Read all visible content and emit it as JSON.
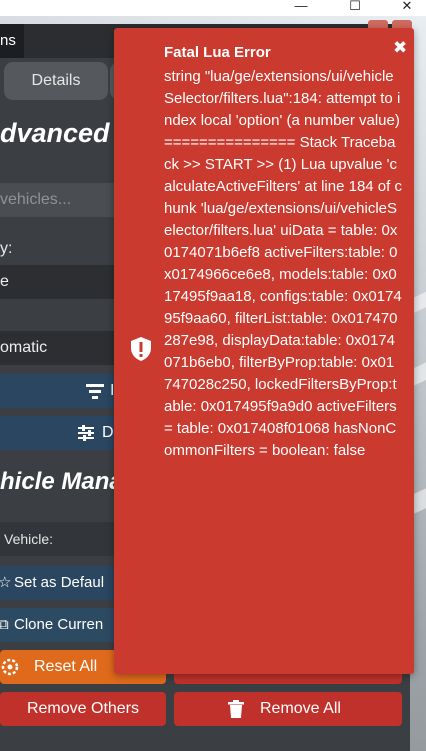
{
  "window": {
    "minimize": "—",
    "maximize": "☐",
    "close": "✕"
  },
  "tabs": {
    "left_fragment": "ns",
    "details_label": "Details"
  },
  "headings": {
    "advanced": "dvanced C",
    "vehicle_management": "hicle Mana"
  },
  "search": {
    "placeholder": "vehicles..."
  },
  "filters": {
    "label": "y:",
    "select1_value": "e",
    "select2_value": "omatic"
  },
  "buttons": {
    "sort_fragment": "I",
    "details_fragment": "D",
    "vehicle_row": "Vehicle:",
    "set_default": "Set as Defaul",
    "clone_current": "Clone Curren",
    "reset_all": "Reset All",
    "remove_others": "Remove Others",
    "remove_all": "Remove All"
  },
  "toast": {
    "title": "Fatal Lua Error",
    "message": "string \"lua/ge/extensions/ui/vehicleSelector/filters.lua\":184: attempt to index local 'option' (a number value) =============== Stack Traceback >> START >> (1) Lua upvalue 'calculateActiveFilters' at line 184 of chunk 'lua/ge/extensions/ui/vehicleSelector/filters.lua' uiData = table: 0x0174071b6ef8 activeFilters:table: 0x0174966ce6e8, models:table: 0x017495f9aa18, configs:table: 0x017495f9aa60, filterList:table: 0x017470287e98, displayData:table: 0x0174071b6eb0, filterByProp:table: 0x01747028c250, lockedFiltersByProp:table: 0x017495f9a9d0 activeFilters = table: 0x017408f01068 hasNonCommonFilters = boolean: false",
    "close_icon": "close-icon",
    "alert_icon": "shield-alert-icon"
  },
  "colors": {
    "toast_bg": "#cb3a2f",
    "reset": "#e06a1b",
    "danger": "#c0312b",
    "panel": "#3b3e43"
  }
}
